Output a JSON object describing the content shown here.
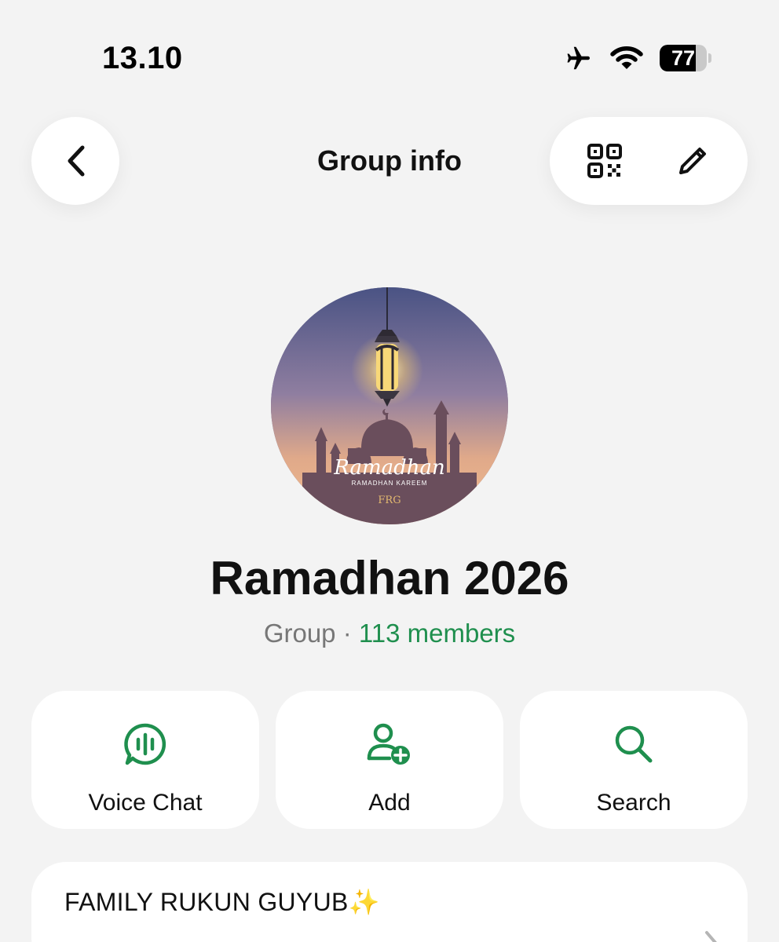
{
  "status_bar": {
    "time": "13.10",
    "battery_level": "77",
    "battery_fraction": 0.77,
    "icons": [
      "airplane-icon",
      "wifi-icon",
      "battery-icon"
    ]
  },
  "nav": {
    "title": "Group info",
    "back_icon": "chevron-left-icon",
    "right_icons": [
      "qr-code-icon",
      "pencil-icon"
    ]
  },
  "avatar": {
    "script_text": "Ramadhan",
    "sub_text": "RAMADHAN KAREEM",
    "monogram": "FRG"
  },
  "group": {
    "name": "Ramadhan 2026",
    "type_label": "Group",
    "separator": " · ",
    "members": "113 members"
  },
  "actions": [
    {
      "label": "Voice Chat",
      "icon": "voice-chat-icon"
    },
    {
      "label": "Add",
      "icon": "add-person-icon"
    },
    {
      "label": "Search",
      "icon": "search-icon"
    }
  ],
  "description": {
    "text": "FAMILY RUKUN GUYUB✨"
  },
  "colors": {
    "accent_green": "#1f8f4e",
    "background": "#f3f3f3",
    "card": "#ffffff"
  }
}
